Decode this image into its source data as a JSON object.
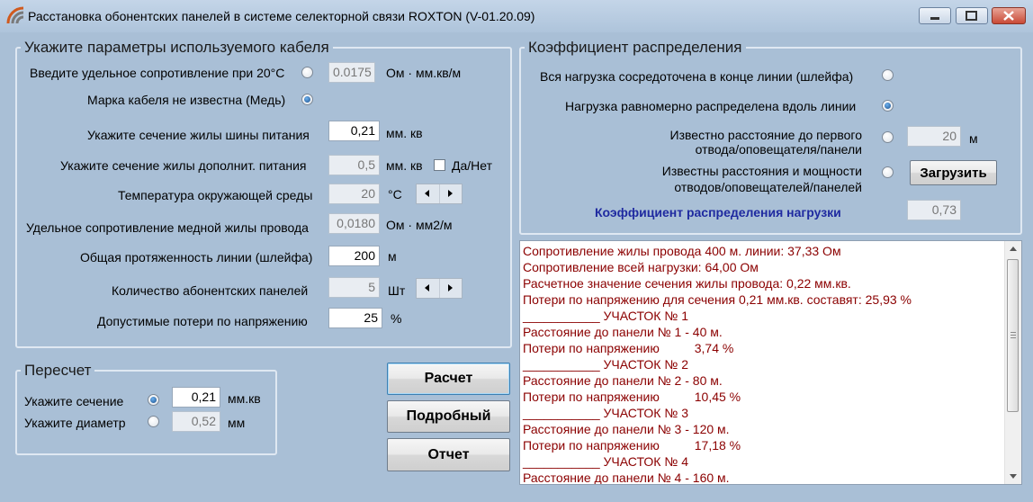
{
  "window": {
    "title": "Расстановка обонентских панелей в системе селекторной связи ROXTON (V-01.20.09)",
    "icon": "app-icon"
  },
  "cable_group": {
    "legend": "Укажите параметры используемого кабеля",
    "resistivity_label": "Введите удельное сопротивление при 20°C",
    "resistivity_value": "0.0175",
    "resistivity_unit": "Ом · мм.кв/м",
    "unknown_brand_label": "Марка кабеля не известна (Медь)",
    "bus_section_label": "Укажите сечение жилы шины питания",
    "bus_section_value": "0,21",
    "bus_section_unit": "мм. кв",
    "aux_section_label": "Укажите сечение жилы дополнит. питания",
    "aux_section_value": "0,5",
    "aux_section_unit": "мм. кв",
    "aux_checkbox_label": "Да/Нет",
    "temperature_label": "Температура окружающей среды",
    "temperature_value": "20",
    "temperature_unit": "°C",
    "copper_resistivity_label": "Удельное сопротивление медной жилы провода",
    "copper_resistivity_value": "0,0180",
    "copper_resistivity_unit": "Ом · мм2/м",
    "line_length_label": "Общая протяженность линии (шлейфа)",
    "line_length_value": "200",
    "line_length_unit": "м",
    "panels_count_label": "Количество абонентских панелей",
    "panels_count_value": "5",
    "panels_count_unit": "Шт",
    "voltage_loss_label": "Допустимые потери по напряжению",
    "voltage_loss_value": "25",
    "voltage_loss_unit": "%"
  },
  "recalc_group": {
    "legend": "Пересчет",
    "section_label": "Укажите сечение",
    "section_value": "0,21",
    "section_unit": "мм.кв",
    "diameter_label": "Укажите диаметр",
    "diameter_value": "0,52",
    "diameter_unit": "мм"
  },
  "buttons": {
    "calculate": "Расчет",
    "detailed": "Подробный",
    "report": "Отчет",
    "load": "Загрузить"
  },
  "distribution_group": {
    "legend": "Коэффициент распределения",
    "option_end_load": "Вся нагрузка сосредоточена в конце линии (шлейфа)",
    "option_uniform": "Нагрузка равномерно распределена вдоль линии",
    "option_first_distance_line1": "Известно расстояние до первого",
    "option_first_distance_line2": "отвода/оповещателя/панели",
    "first_distance_value": "20",
    "first_distance_unit": "м",
    "option_known_line1": "Известны расстояния и мощности",
    "option_known_line2": "отводов/оповещателей/панелей",
    "coef_label": "Коэффициент распределения нагрузки",
    "coef_value": "0,73"
  },
  "log_lines": [
    "Сопротивление жилы провода 400 м. линии: 37,33 Ом",
    "Сопротивление всей нагрузки: 64,00 Ом",
    "Расчетное значение сечения жилы провода: 0,22 мм.кв.",
    "Потери по напряжению для сечения 0,21 мм.кв. составят: 25,93 %",
    "___________ УЧАСТОК № 1",
    "Расстояние до панели № 1 - 40 м.",
    "Потери по напряжению          3,74 %",
    "___________ УЧАСТОК № 2",
    "Расстояние до панели № 2 - 80 м.",
    "Потери по напряжению          10,45 %",
    "___________ УЧАСТОК № 3",
    "Расстояние до панели № 3 - 120 м.",
    "Потери по напряжению          17,18 %",
    "___________ УЧАСТОК № 4",
    "Расстояние до панели № 4 - 160 м."
  ]
}
